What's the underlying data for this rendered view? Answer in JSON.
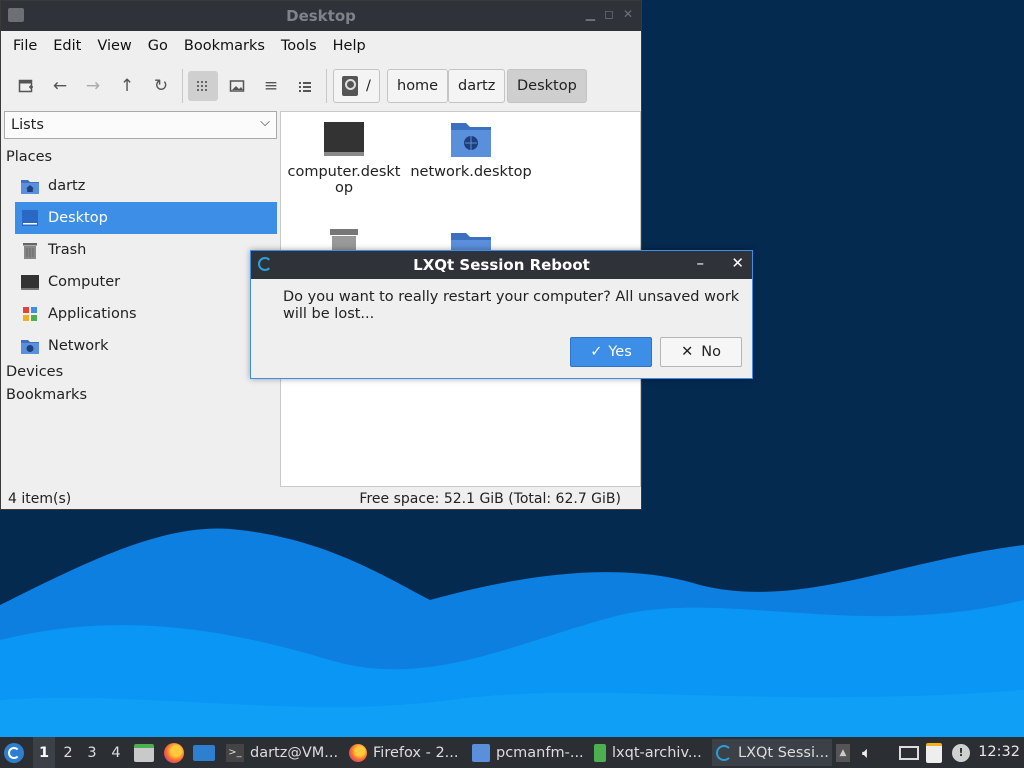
{
  "file_manager": {
    "title": "Desktop",
    "menu": [
      "File",
      "Edit",
      "View",
      "Go",
      "Bookmarks",
      "Tools",
      "Help"
    ],
    "path_root": "/",
    "breadcrumbs": [
      "home",
      "dartz",
      "Desktop"
    ],
    "side_view_mode": "Lists",
    "sections": {
      "places": "Places",
      "devices": "Devices",
      "bookmarks": "Bookmarks"
    },
    "places": [
      {
        "label": "dartz",
        "icon": "home-folder-icon"
      },
      {
        "label": "Desktop",
        "icon": "desktop-icon",
        "selected": true
      },
      {
        "label": "Trash",
        "icon": "trash-icon"
      },
      {
        "label": "Computer",
        "icon": "computer-icon"
      },
      {
        "label": "Applications",
        "icon": "applications-icon"
      },
      {
        "label": "Network",
        "icon": "network-icon"
      }
    ],
    "files": [
      {
        "name": "computer.desktop",
        "icon": "computer-icon"
      },
      {
        "name": "network.desktop",
        "icon": "network-folder-icon"
      },
      {
        "name": "",
        "icon": "trash-icon"
      },
      {
        "name": "",
        "icon": "folder-icon"
      }
    ],
    "status_left": "4 item(s)",
    "status_right": "Free space: 52.1 GiB (Total: 62.7 GiB)"
  },
  "dialog": {
    "title": "LXQt Session Reboot",
    "message": "Do you want to really restart your computer? All unsaved work will be lost...",
    "yes_label": "Yes",
    "no_label": "No",
    "minimize_glyph": "–",
    "close_glyph": "✕"
  },
  "taskbar": {
    "desktops": [
      "1",
      "2",
      "3",
      "4"
    ],
    "current_desktop": "1",
    "tasks": [
      {
        "label": "dartz@VM...",
        "icon": "terminal-icon"
      },
      {
        "label": "Firefox - 2...",
        "icon": "firefox-icon"
      },
      {
        "label": "pcmanfm-...",
        "icon": "folder-icon"
      },
      {
        "label": "lxqt-archiv...",
        "icon": "archive-icon"
      },
      {
        "label": "LXQt Sessi...",
        "icon": "lxqt-icon",
        "active": true
      }
    ],
    "clock": "12:32"
  },
  "colors": {
    "accent": "#3d8ee6",
    "titlebar": "#2f3238",
    "taskbar": "#2b2e33",
    "wallpaper_dark": "#052a50",
    "wallpaper_wave": "#0a8cf0"
  }
}
